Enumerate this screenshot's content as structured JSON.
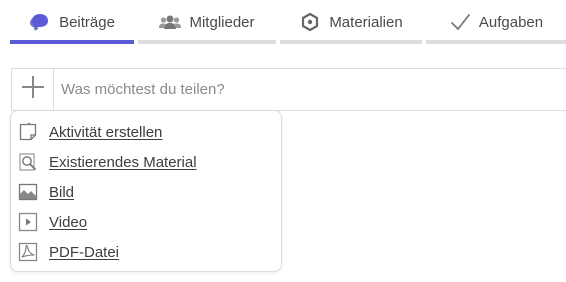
{
  "tabs": [
    {
      "label": "Beiträge",
      "icon": "chat-bubbles-icon",
      "active": true
    },
    {
      "label": "Mitglieder",
      "icon": "members-icon",
      "active": false
    },
    {
      "label": "Materialien",
      "icon": "materials-icon",
      "active": false
    },
    {
      "label": "Aufgaben",
      "icon": "checkmark-icon",
      "active": false
    }
  ],
  "composer": {
    "placeholder": "Was möchtest du teilen?",
    "value": ""
  },
  "menu": {
    "items": [
      {
        "label": "Aktivität erstellen",
        "icon": "activity-note-icon"
      },
      {
        "label": "Existierendes Material",
        "icon": "search-material-icon"
      },
      {
        "label": "Bild",
        "icon": "image-icon"
      },
      {
        "label": "Video",
        "icon": "video-icon"
      },
      {
        "label": "PDF-Datei",
        "icon": "pdf-icon"
      }
    ]
  },
  "colors": {
    "accent": "#5b5bd6",
    "tab_inactive_bar": "#dcdcdc",
    "border": "#dcdcdc"
  }
}
